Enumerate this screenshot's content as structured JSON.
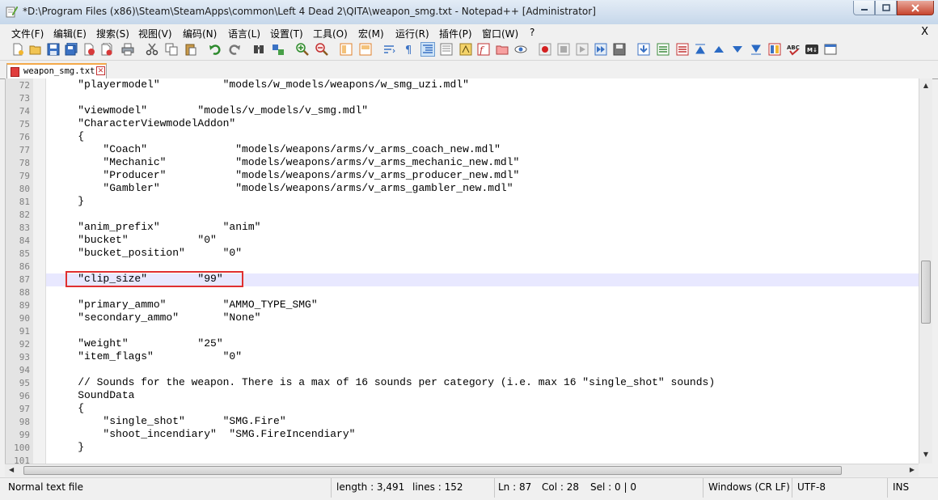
{
  "window": {
    "title": "*D:\\Program Files (x86)\\Steam\\SteamApps\\common\\Left 4 Dead 2\\QITA\\weapon_smg.txt - Notepad++ [Administrator]"
  },
  "menu": {
    "items": [
      "文件(F)",
      "编辑(E)",
      "搜索(S)",
      "视图(V)",
      "编码(N)",
      "语言(L)",
      "设置(T)",
      "工具(O)",
      "宏(M)",
      "运行(R)",
      "插件(P)",
      "窗口(W)",
      "?"
    ],
    "close_label": "X"
  },
  "tabs": [
    {
      "label": "weapon_smg.txt"
    }
  ],
  "editor": {
    "lines": [
      {
        "n": "72",
        "text": "    \"playermodel\"          \"models/w_models/weapons/w_smg_uzi.mdl\""
      },
      {
        "n": "73",
        "text": ""
      },
      {
        "n": "74",
        "text": "    \"viewmodel\"        \"models/v_models/v_smg.mdl\""
      },
      {
        "n": "75",
        "text": "    \"CharacterViewmodelAddon\""
      },
      {
        "n": "76",
        "text": "    {"
      },
      {
        "n": "77",
        "text": "        \"Coach\"              \"models/weapons/arms/v_arms_coach_new.mdl\""
      },
      {
        "n": "78",
        "text": "        \"Mechanic\"           \"models/weapons/arms/v_arms_mechanic_new.mdl\""
      },
      {
        "n": "79",
        "text": "        \"Producer\"           \"models/weapons/arms/v_arms_producer_new.mdl\""
      },
      {
        "n": "80",
        "text": "        \"Gambler\"            \"models/weapons/arms/v_arms_gambler_new.mdl\""
      },
      {
        "n": "81",
        "text": "    }"
      },
      {
        "n": "82",
        "text": ""
      },
      {
        "n": "83",
        "text": "    \"anim_prefix\"          \"anim\""
      },
      {
        "n": "84",
        "text": "    \"bucket\"           \"0\""
      },
      {
        "n": "85",
        "text": "    \"bucket_position\"      \"0\""
      },
      {
        "n": "86",
        "text": ""
      },
      {
        "n": "87",
        "text": "    \"clip_size\"        \"99\""
      },
      {
        "n": "88",
        "text": ""
      },
      {
        "n": "89",
        "text": "    \"primary_ammo\"         \"AMMO_TYPE_SMG\""
      },
      {
        "n": "90",
        "text": "    \"secondary_ammo\"       \"None\""
      },
      {
        "n": "91",
        "text": ""
      },
      {
        "n": "92",
        "text": "    \"weight\"           \"25\""
      },
      {
        "n": "93",
        "text": "    \"item_flags\"           \"0\""
      },
      {
        "n": "94",
        "text": ""
      },
      {
        "n": "95",
        "text": "    // Sounds for the weapon. There is a max of 16 sounds per category (i.e. max 16 \"single_shot\" sounds)"
      },
      {
        "n": "96",
        "text": "    SoundData"
      },
      {
        "n": "97",
        "text": "    {"
      },
      {
        "n": "98",
        "text": "        \"single_shot\"      \"SMG.Fire\""
      },
      {
        "n": "99",
        "text": "        \"shoot_incendiary\"  \"SMG.FireIncendiary\""
      },
      {
        "n": "100",
        "text": "    }"
      },
      {
        "n": "101",
        "text": ""
      }
    ]
  },
  "status": {
    "file_type": "Normal text file",
    "length": "length : 3,491",
    "lines": "lines : 152",
    "ln": "Ln : 87",
    "col": "Col : 28",
    "sel": "Sel : 0 | 0",
    "eol": "Windows (CR LF)",
    "encoding": "UTF-8",
    "mode": "INS"
  }
}
